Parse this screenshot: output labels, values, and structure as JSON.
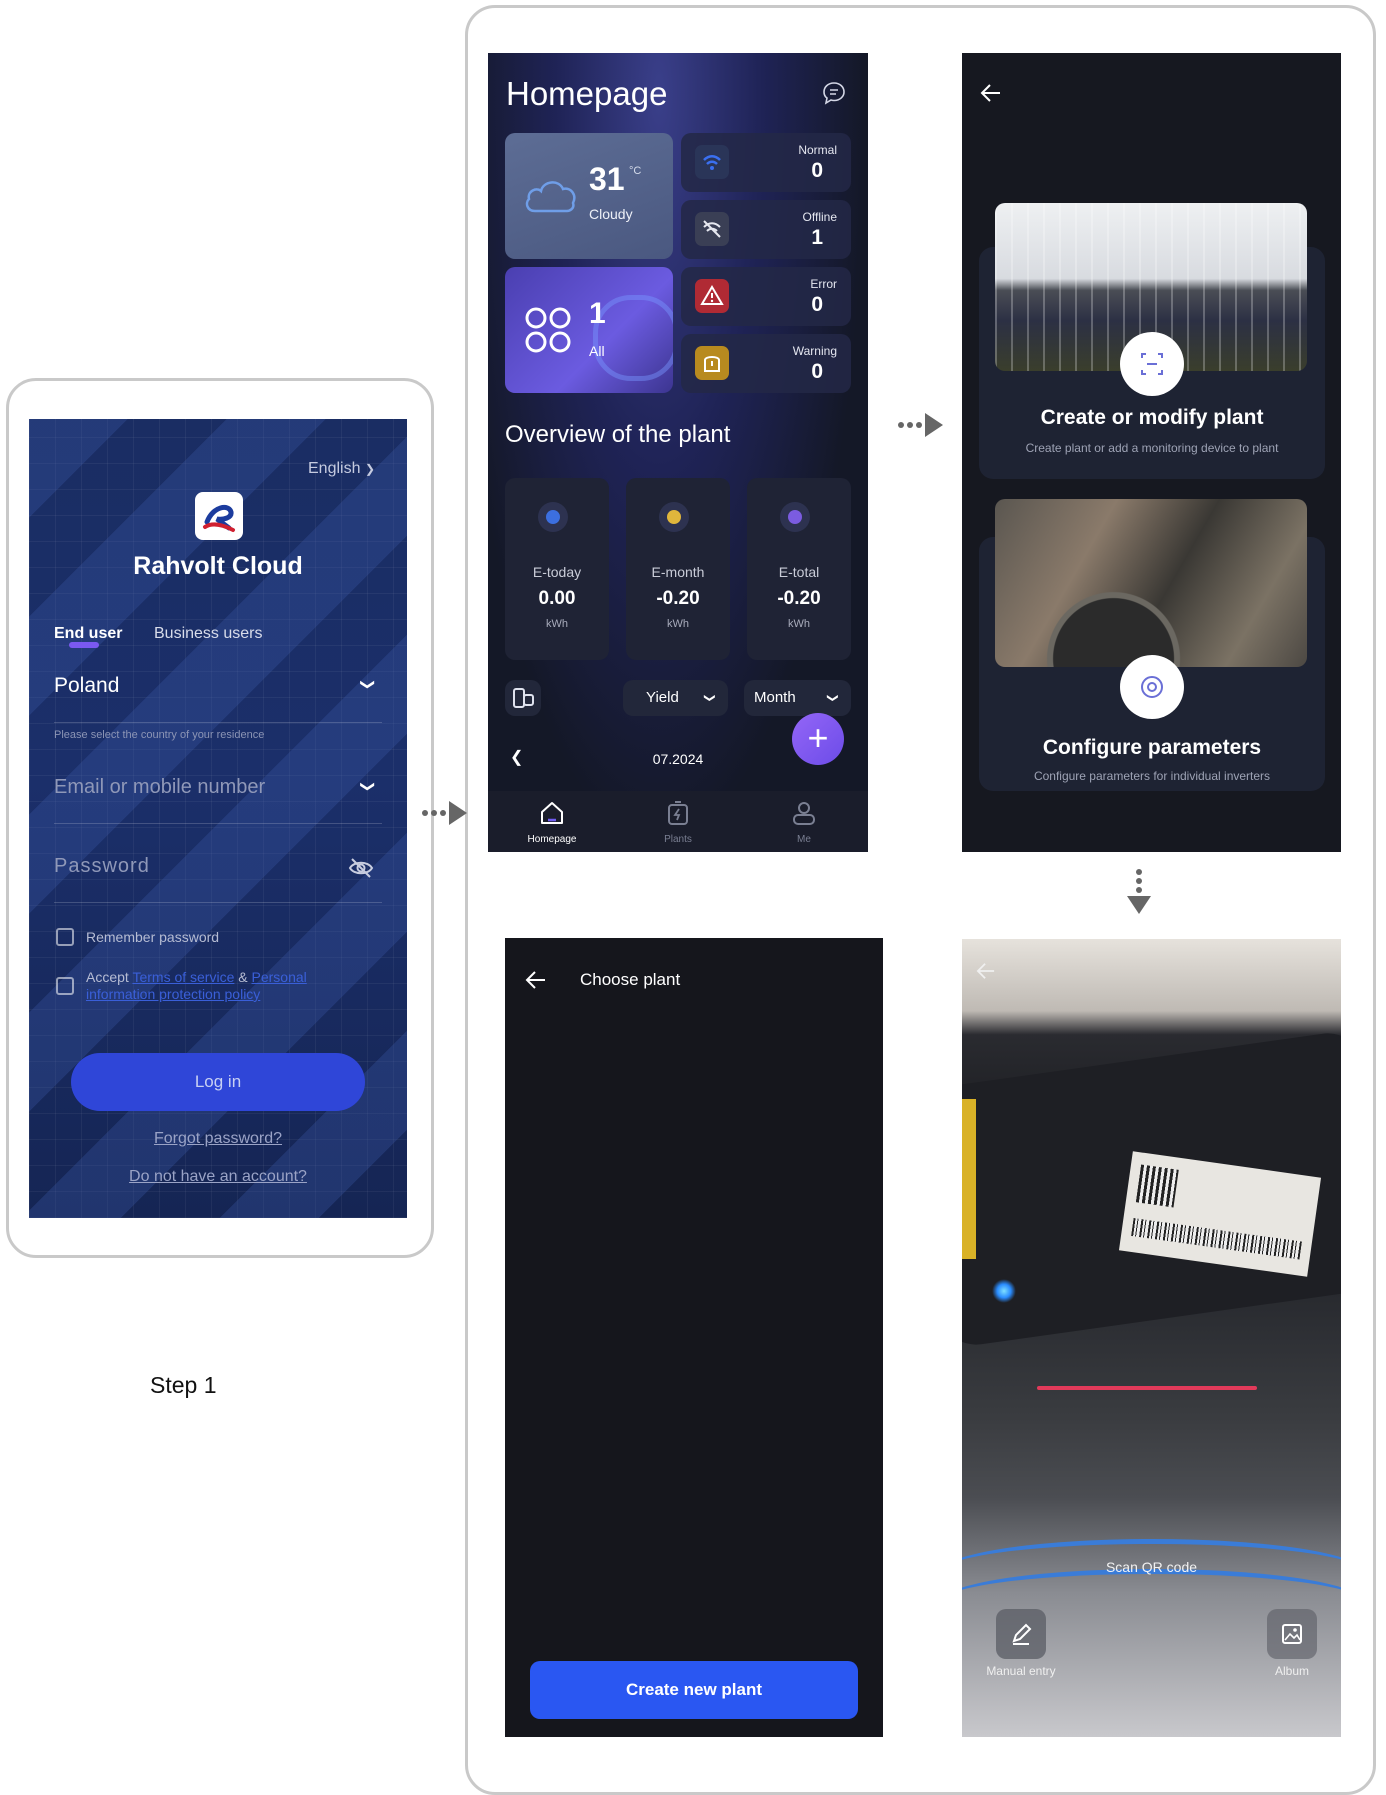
{
  "step_label": "Step 1",
  "login": {
    "language": "English",
    "app_name": "Rahvolt Cloud",
    "tabs": [
      "End user",
      "Business users"
    ],
    "country_value": "Poland",
    "country_hint": "Please select the country of your residence",
    "email_placeholder": "Email or mobile number",
    "password_placeholder": "Password",
    "remember_label": "Remember password",
    "accept_prefix": "Accept",
    "terms_link": "Terms of service",
    "amp": "&",
    "privacy_link_1": "Personal",
    "privacy_link_2": "information protection policy",
    "login_button": "Log in",
    "forgot_link": "Forgot password?",
    "no_account_link": "Do not have an account?"
  },
  "home": {
    "title": "Homepage",
    "weather": {
      "temp": "31",
      "unit": "°C",
      "condition": "Cloudy"
    },
    "all": {
      "count": "1",
      "label": "All"
    },
    "stats": [
      {
        "label": "Normal",
        "value": "0",
        "color": "#2f5bd6",
        "icon": "wifi-icon"
      },
      {
        "label": "Offline",
        "value": "1",
        "color": "#3a3f55",
        "icon": "wifi-off-icon"
      },
      {
        "label": "Error",
        "value": "0",
        "color": "#b02a34",
        "icon": "alert-icon"
      },
      {
        "label": "Warning",
        "value": "0",
        "color": "#b88a1f",
        "icon": "warning-icon"
      }
    ],
    "overview_title": "Overview of the plant",
    "overview": [
      {
        "label": "E-today",
        "value": "0.00",
        "unit": "kWh",
        "color": "#3c6fe0"
      },
      {
        "label": "E-month",
        "value": "-0.20",
        "unit": "kWh",
        "color": "#e0b63c"
      },
      {
        "label": "E-total",
        "value": "-0.20",
        "unit": "kWh",
        "color": "#7b5ce0"
      }
    ],
    "yield_select": "Yield",
    "period_select": "Month",
    "date": "07.2024",
    "nav": [
      "Homepage",
      "Plants",
      "Me"
    ]
  },
  "options": {
    "create_title": "Create or modify plant",
    "create_sub": "Create plant or add a monitoring device to plant",
    "config_title": "Configure parameters",
    "config_sub": "Configure parameters for individual inverters"
  },
  "choose": {
    "title": "Choose plant",
    "create_button": "Create new plant"
  },
  "scan": {
    "label": "Scan QR code",
    "manual": "Manual entry",
    "album": "Album"
  },
  "colors": {
    "accent_blue": "#2a57f2",
    "login_button": "#2f46d8",
    "purple_fab": "#7d56f0"
  }
}
